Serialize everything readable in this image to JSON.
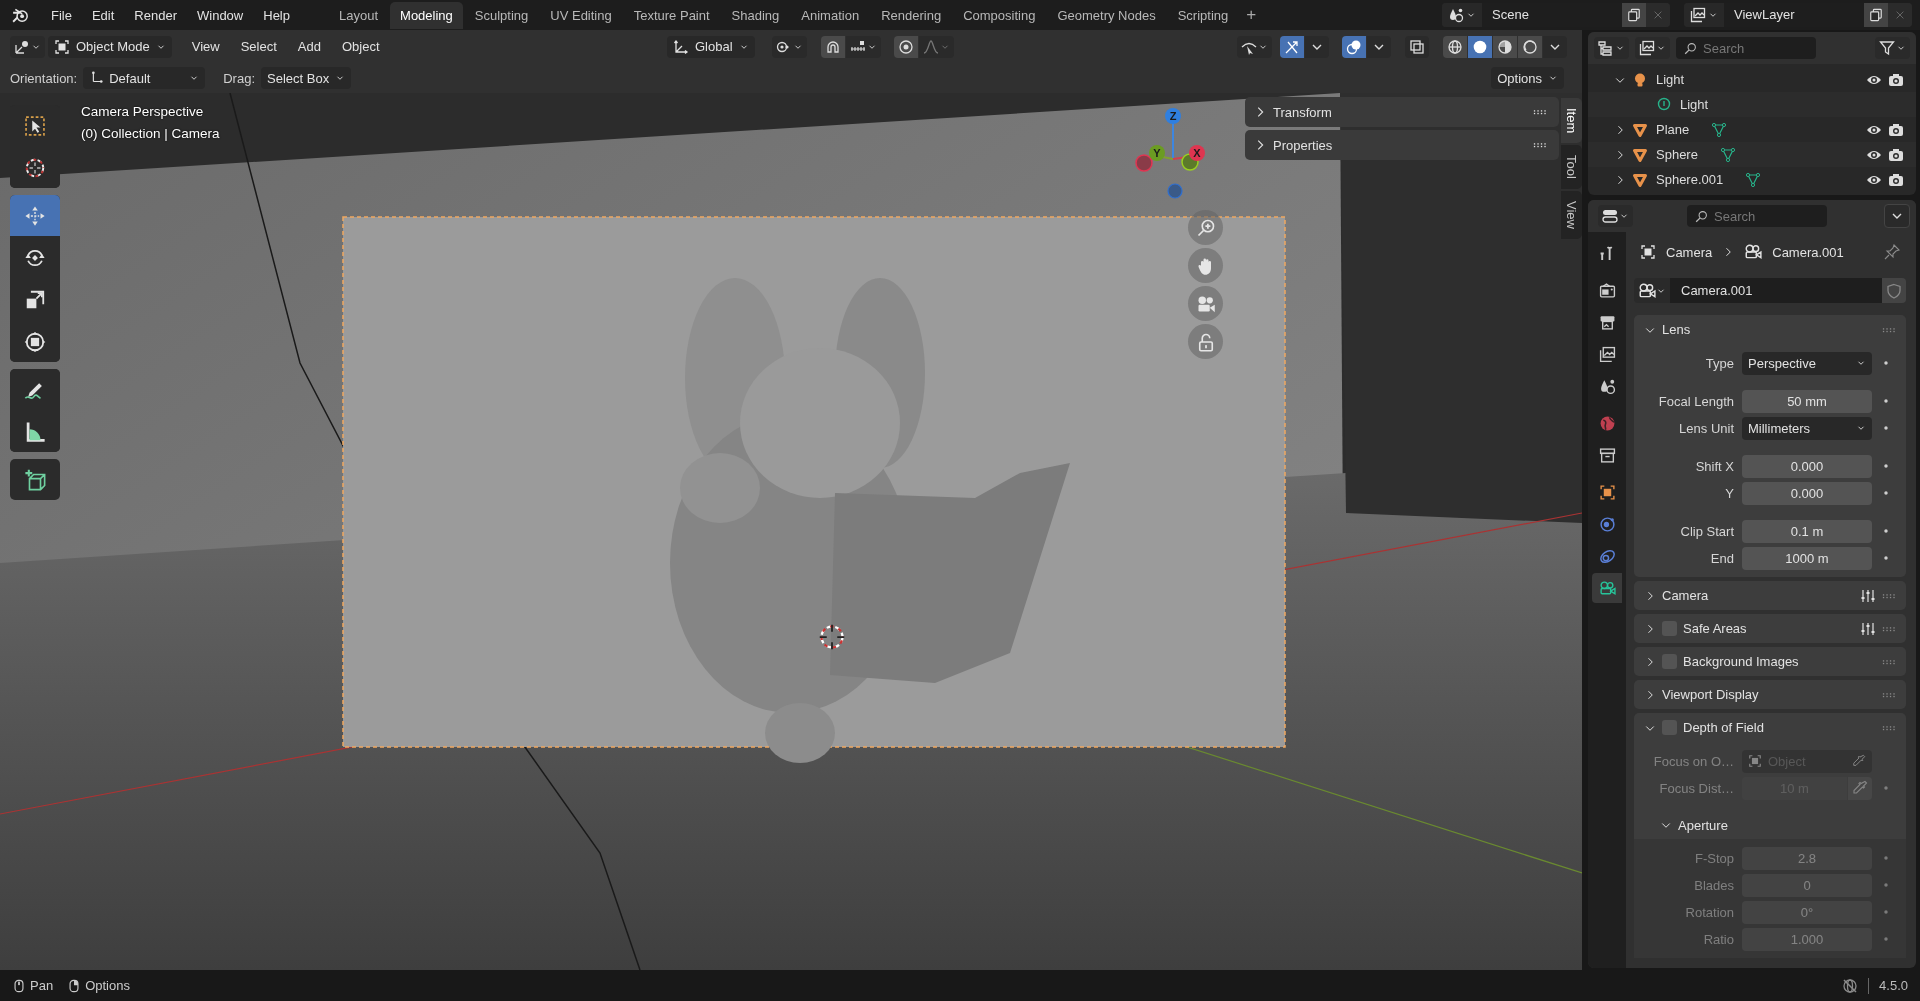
{
  "topbar": {
    "menus": [
      "File",
      "Edit",
      "Render",
      "Window",
      "Help"
    ],
    "workspaces": [
      {
        "label": "Layout",
        "selected": false
      },
      {
        "label": "Modeling",
        "selected": true
      },
      {
        "label": "Sculpting",
        "selected": false
      },
      {
        "label": "UV Editing",
        "selected": false
      },
      {
        "label": "Texture Paint",
        "selected": false
      },
      {
        "label": "Shading",
        "selected": false
      },
      {
        "label": "Animation",
        "selected": false
      },
      {
        "label": "Rendering",
        "selected": false
      },
      {
        "label": "Compositing",
        "selected": false
      },
      {
        "label": "Geometry Nodes",
        "selected": false
      },
      {
        "label": "Scripting",
        "selected": false
      }
    ],
    "add_workspace": "+",
    "scene": "Scene",
    "view_layer": "ViewLayer"
  },
  "header": {
    "mode": "Object Mode",
    "menus": [
      "View",
      "Select",
      "Add",
      "Object"
    ],
    "transform_orientation": "Global",
    "gizmos_on": true,
    "overlays_on": true,
    "xray_on": false,
    "shading": [
      {
        "kind": "wireframe",
        "selected": false
      },
      {
        "kind": "solid",
        "selected": true
      },
      {
        "kind": "material",
        "selected": false
      },
      {
        "kind": "rendered",
        "selected": false
      }
    ]
  },
  "tool_settings": {
    "orientation_label": "Orientation:",
    "orientation": "Default",
    "drag_label": "Drag:",
    "drag": "Select Box",
    "options": "Options"
  },
  "toolbar": [
    [
      {
        "kind": "select_box",
        "selected": false
      },
      {
        "kind": "cursor",
        "selected": false
      }
    ],
    [
      {
        "kind": "move",
        "selected": true
      },
      {
        "kind": "rotate",
        "selected": false
      },
      {
        "kind": "scale",
        "selected": false
      },
      {
        "kind": "transform",
        "selected": false
      }
    ],
    [
      {
        "kind": "annotate",
        "selected": false
      },
      {
        "kind": "measure",
        "selected": false
      }
    ],
    [
      {
        "kind": "add_cube",
        "selected": false
      }
    ]
  ],
  "viewport": {
    "title": "Camera Perspective",
    "subtitle": "(0) Collection | Camera",
    "axes": [
      {
        "label": "Z",
        "color": "#2f7fdf"
      },
      {
        "label": "Y",
        "color": "#6b9c22"
      },
      {
        "label": "X",
        "color": "#de3550"
      }
    ],
    "navigation": [
      {
        "kind": "zoom"
      },
      {
        "kind": "pan"
      },
      {
        "kind": "camera"
      },
      {
        "kind": "lock"
      }
    ]
  },
  "sidebar": {
    "panels": [
      {
        "label": "Transform",
        "expanded": false
      },
      {
        "label": "Properties",
        "expanded": false
      }
    ],
    "tabs": [
      {
        "label": "Item",
        "selected": true
      },
      {
        "label": "Tool",
        "selected": false
      },
      {
        "label": "View",
        "selected": false
      }
    ]
  },
  "outliner": {
    "search_placeholder": "Search",
    "items": [
      {
        "name": "Light",
        "kind": "light",
        "expanded": true,
        "visible": true,
        "children": [
          {
            "name": "Light",
            "kind": "light_data"
          }
        ]
      },
      {
        "name": "Plane",
        "kind": "mesh",
        "expanded": false,
        "visible": true
      },
      {
        "name": "Sphere",
        "kind": "mesh",
        "expanded": false,
        "visible": true
      },
      {
        "name": "Sphere.001",
        "kind": "mesh",
        "expanded": false,
        "visible": true
      }
    ]
  },
  "properties": {
    "search_placeholder": "Search",
    "breadcrumb": [
      "Camera",
      "Camera.001"
    ],
    "datablock": "Camera.001",
    "tabs": [
      {
        "kind": "tool",
        "selected": false
      },
      {
        "kind": "render",
        "selected": false
      },
      {
        "kind": "output",
        "selected": false
      },
      {
        "kind": "view_layer",
        "selected": false
      },
      {
        "kind": "scene",
        "selected": false
      },
      {
        "kind": "world",
        "selected": false
      },
      {
        "kind": "collection",
        "selected": false
      },
      {
        "kind": "object",
        "selected": false
      },
      {
        "kind": "physics",
        "selected": false
      },
      {
        "kind": "constraints",
        "selected": false
      },
      {
        "kind": "data",
        "selected": true
      }
    ],
    "panels": [
      {
        "label": "Lens",
        "expanded": true,
        "groups": [
          [
            {
              "kind": "dropdown",
              "label": "Type",
              "value": "Perspective"
            }
          ],
          [
            {
              "kind": "number",
              "label": "Focal Length",
              "value": "50 mm"
            },
            {
              "kind": "dropdown",
              "label": "Lens Unit",
              "value": "Millimeters"
            }
          ],
          [
            {
              "kind": "number",
              "label": "Shift X",
              "value": "0.000"
            },
            {
              "kind": "number",
              "label": "Y",
              "value": "0.000"
            }
          ],
          [
            {
              "kind": "number",
              "label": "Clip Start",
              "value": "0.1 m"
            },
            {
              "kind": "number",
              "label": "End",
              "value": "1000 m"
            }
          ]
        ]
      },
      {
        "label": "Camera",
        "expanded": false,
        "presets": true
      },
      {
        "label": "Safe Areas",
        "expanded": false,
        "checked": false,
        "presets": true
      },
      {
        "label": "Background Images",
        "expanded": false,
        "checked": false
      },
      {
        "label": "Viewport Display",
        "expanded": false
      },
      {
        "label": "Depth of Field",
        "expanded": true,
        "checked": false,
        "groups": [
          [
            {
              "kind": "object",
              "label": "Focus on O…",
              "placeholder": "Object",
              "disabled": true
            },
            {
              "kind": "number_picker",
              "label": "Focus Dist…",
              "value": "10 m",
              "disabled": true
            }
          ]
        ],
        "subpanels": [
          {
            "label": "Aperture",
            "expanded": true,
            "groups": [
              [
                {
                  "kind": "number",
                  "label": "F-Stop",
                  "value": "2.8",
                  "disabled": true
                },
                {
                  "kind": "number",
                  "label": "Blades",
                  "value": "0",
                  "disabled": true
                },
                {
                  "kind": "number",
                  "label": "Rotation",
                  "value": "0°",
                  "disabled": true
                },
                {
                  "kind": "number",
                  "label": "Ratio",
                  "value": "1.000",
                  "disabled": true
                }
              ]
            ]
          }
        ]
      }
    ]
  },
  "status_bar": {
    "hints": [
      {
        "kind": "mouse_middle",
        "label": "Pan"
      },
      {
        "kind": "mouse_right",
        "label": "Options"
      }
    ],
    "version": "4.5.0"
  }
}
